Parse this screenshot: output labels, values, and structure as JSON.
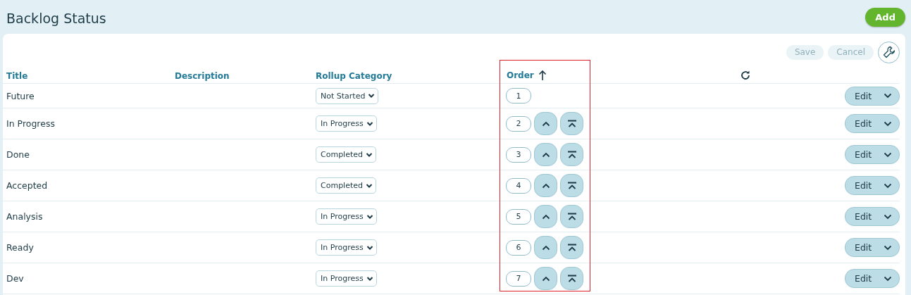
{
  "page": {
    "title": "Backlog Status"
  },
  "add_button": "Add",
  "toolbar": {
    "save": {
      "label": "Save",
      "disabled": true
    },
    "cancel": {
      "label": "Cancel",
      "disabled": true
    }
  },
  "table": {
    "columns": [
      {
        "label": "Title"
      },
      {
        "label": "Description"
      },
      {
        "label": "Rollup Category"
      },
      {
        "label": "Order",
        "sorted": true
      }
    ],
    "order_column_highlighted": true,
    "rows": [
      {
        "title": "Future",
        "rollup": "Not Started",
        "order": "1",
        "can_move_up": false,
        "edit": "Edit"
      },
      {
        "title": "In Progress",
        "rollup": "In Progress",
        "order": "2",
        "can_move_up": true,
        "edit": "Edit"
      },
      {
        "title": "Done",
        "rollup": "Completed",
        "order": "3",
        "can_move_up": true,
        "edit": "Edit"
      },
      {
        "title": "Accepted",
        "rollup": "Completed",
        "order": "4",
        "can_move_up": true,
        "edit": "Edit"
      },
      {
        "title": "Analysis",
        "rollup": "In Progress",
        "order": "5",
        "can_move_up": true,
        "edit": "Edit"
      },
      {
        "title": "Ready",
        "rollup": "In Progress",
        "order": "6",
        "can_move_up": true,
        "edit": "Edit"
      },
      {
        "title": "Dev",
        "rollup": "In Progress",
        "order": "7",
        "can_move_up": true,
        "edit": "Edit"
      }
    ]
  }
}
